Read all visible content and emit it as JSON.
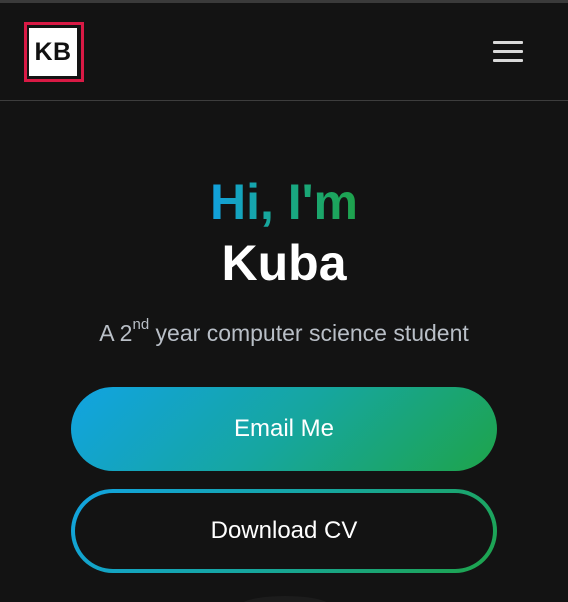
{
  "header": {
    "logo_text": "KB",
    "menu_icon": "hamburger-menu-icon"
  },
  "hero": {
    "greeting": "Hi, I'm",
    "name": "Kuba",
    "subtitle_prefix": "A 2",
    "subtitle_sup": "nd",
    "subtitle_suffix": " year computer science student"
  },
  "buttons": {
    "email_label": "Email Me",
    "cv_label": "Download CV"
  },
  "colors": {
    "background": "#131313",
    "accent_red": "#d91a45",
    "gradient_start": "#11a3e2",
    "gradient_end": "#1ea44a"
  }
}
